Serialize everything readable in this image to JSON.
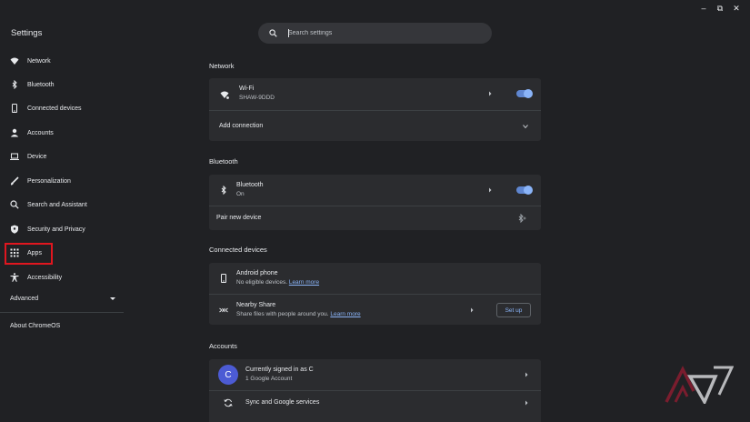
{
  "app": {
    "title": "Settings"
  },
  "window_controls": {
    "minimize": "–",
    "restore": "⧉",
    "close": "✕"
  },
  "search": {
    "placeholder": "Search settings"
  },
  "sidebar": {
    "items": [
      {
        "label": "Network",
        "icon": "wifi-icon"
      },
      {
        "label": "Bluetooth",
        "icon": "bluetooth-icon"
      },
      {
        "label": "Connected devices",
        "icon": "phone-icon"
      },
      {
        "label": "Accounts",
        "icon": "person-icon"
      },
      {
        "label": "Device",
        "icon": "laptop-icon"
      },
      {
        "label": "Personalization",
        "icon": "brush-icon"
      },
      {
        "label": "Search and Assistant",
        "icon": "search-icon"
      },
      {
        "label": "Security and Privacy",
        "icon": "shield-icon"
      },
      {
        "label": "Apps",
        "icon": "apps-grid-icon"
      },
      {
        "label": "Accessibility",
        "icon": "accessibility-icon"
      }
    ],
    "advanced": "Advanced",
    "about": "About ChromeOS",
    "highlight_color": "#e0161f"
  },
  "network": {
    "title": "Network",
    "wifi": {
      "label": "Wi-Fi",
      "ssid": "SHAW-9DDD"
    },
    "add_connection": "Add connection"
  },
  "bluetooth": {
    "title": "Bluetooth",
    "bt": {
      "label": "Bluetooth",
      "status": "On"
    },
    "pair": "Pair new device"
  },
  "connected": {
    "title": "Connected devices",
    "android": {
      "label": "Android phone",
      "desc": "No eligible devices.",
      "link": "Learn more"
    },
    "nearby": {
      "label": "Nearby Share",
      "desc": "Share files with people around you.",
      "link": "Learn more",
      "button": "Set up"
    }
  },
  "accounts": {
    "title": "Accounts",
    "user": {
      "initial": "C",
      "label": "Currently signed in as C",
      "desc": "1 Google Account"
    },
    "sync": "Sync and Google services"
  },
  "colors": {
    "background": "#202124",
    "card": "#2b2c2f",
    "accent": "#8ab4f8"
  }
}
